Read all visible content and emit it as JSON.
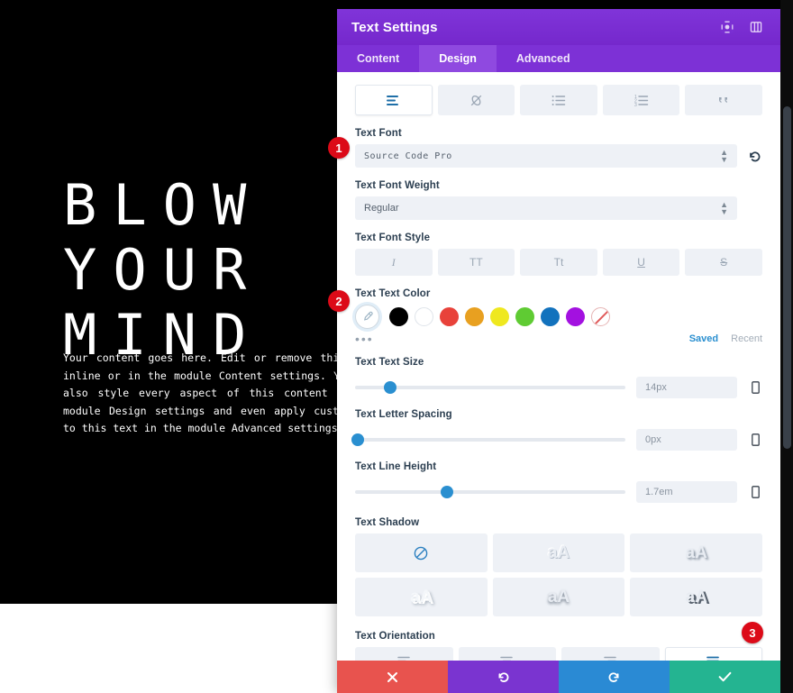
{
  "canvas": {
    "hero_lines": [
      "BLOW",
      "YOUR",
      "MIND"
    ],
    "body_text": "Your content goes here. Edit or remove this text inline or in the module Content settings. You can also style every aspect of this content in the module Design settings and even apply custom CSS to this text in the module Advanced settings.",
    "background_color": "#000000",
    "text_color": "#ffffff"
  },
  "panel": {
    "title": "Text Settings",
    "header_icons": [
      {
        "name": "target-icon",
        "glyph": "☉"
      },
      {
        "name": "layout-toggle-icon",
        "glyph": "▤"
      }
    ],
    "tabs": [
      {
        "label": "Content",
        "active": false
      },
      {
        "label": "Design",
        "active": true
      },
      {
        "label": "Advanced",
        "active": false
      }
    ],
    "toolbar": [
      {
        "name": "paragraph-icon",
        "active": true
      },
      {
        "name": "link-icon",
        "active": false
      },
      {
        "name": "unordered-list-icon",
        "active": false
      },
      {
        "name": "ordered-list-icon",
        "active": false
      },
      {
        "name": "blockquote-icon",
        "active": false
      }
    ],
    "text_font": {
      "label": "Text Font",
      "value": "Source Code Pro",
      "reset_title": "Reset"
    },
    "text_font_weight": {
      "label": "Text Font Weight",
      "value": "Regular"
    },
    "text_font_style": {
      "label": "Text Font Style",
      "options": [
        {
          "label": "I",
          "name": "italic-option"
        },
        {
          "label": "TT",
          "name": "uppercase-option"
        },
        {
          "label": "Tt",
          "name": "capitalize-option"
        },
        {
          "label": "U",
          "name": "underline-option"
        },
        {
          "label": "S",
          "name": "strikethrough-option"
        }
      ]
    },
    "text_color": {
      "label": "Text Text Color",
      "picker_icon": "eyedropper-icon",
      "swatches": [
        {
          "name": "black",
          "hex": "#000000"
        },
        {
          "name": "white",
          "hex": "#ffffff"
        },
        {
          "name": "red",
          "hex": "#e8423a"
        },
        {
          "name": "orange",
          "hex": "#e8a020"
        },
        {
          "name": "yellow",
          "hex": "#efe81f"
        },
        {
          "name": "green",
          "hex": "#5fcb33"
        },
        {
          "name": "blue",
          "hex": "#1272bd"
        },
        {
          "name": "purple",
          "hex": "#a311e0"
        },
        {
          "name": "transparent",
          "hex": "none"
        }
      ],
      "more_label": "•••",
      "saved_label": "Saved",
      "recent_label": "Recent"
    },
    "text_size": {
      "label": "Text Text Size",
      "value": "14px",
      "knob_percent": 13
    },
    "letter_spacing": {
      "label": "Text Letter Spacing",
      "value": "0px",
      "knob_percent": 1
    },
    "line_height": {
      "label": "Text Line Height",
      "value": "1.7em",
      "knob_percent": 34
    },
    "text_shadow": {
      "label": "Text Shadow",
      "options": [
        {
          "name": "shadow-none",
          "glyph": "⊘"
        },
        {
          "name": "shadow-soft",
          "glyph": "aA"
        },
        {
          "name": "shadow-hard",
          "glyph": "aA"
        },
        {
          "name": "shadow-emboss",
          "glyph": "aA"
        },
        {
          "name": "shadow-drop",
          "glyph": "aA"
        },
        {
          "name": "shadow-long",
          "glyph": "aA"
        }
      ]
    },
    "text_orientation": {
      "label": "Text Orientation",
      "options": [
        {
          "name": "align-left",
          "active": false
        },
        {
          "name": "align-center",
          "active": false
        },
        {
          "name": "align-right",
          "active": false
        },
        {
          "name": "align-justify",
          "active": true
        }
      ]
    },
    "actions": [
      {
        "name": "close-button",
        "glyph": "✖",
        "color": "#e8534e"
      },
      {
        "name": "undo-button",
        "glyph": "↺",
        "color": "#7a34d0"
      },
      {
        "name": "redo-button",
        "glyph": "↻",
        "color": "#2a8ad4"
      },
      {
        "name": "save-button",
        "glyph": "✔",
        "color": "#24b491"
      }
    ]
  },
  "markers": [
    {
      "number": "1"
    },
    {
      "number": "2"
    },
    {
      "number": "3"
    }
  ]
}
